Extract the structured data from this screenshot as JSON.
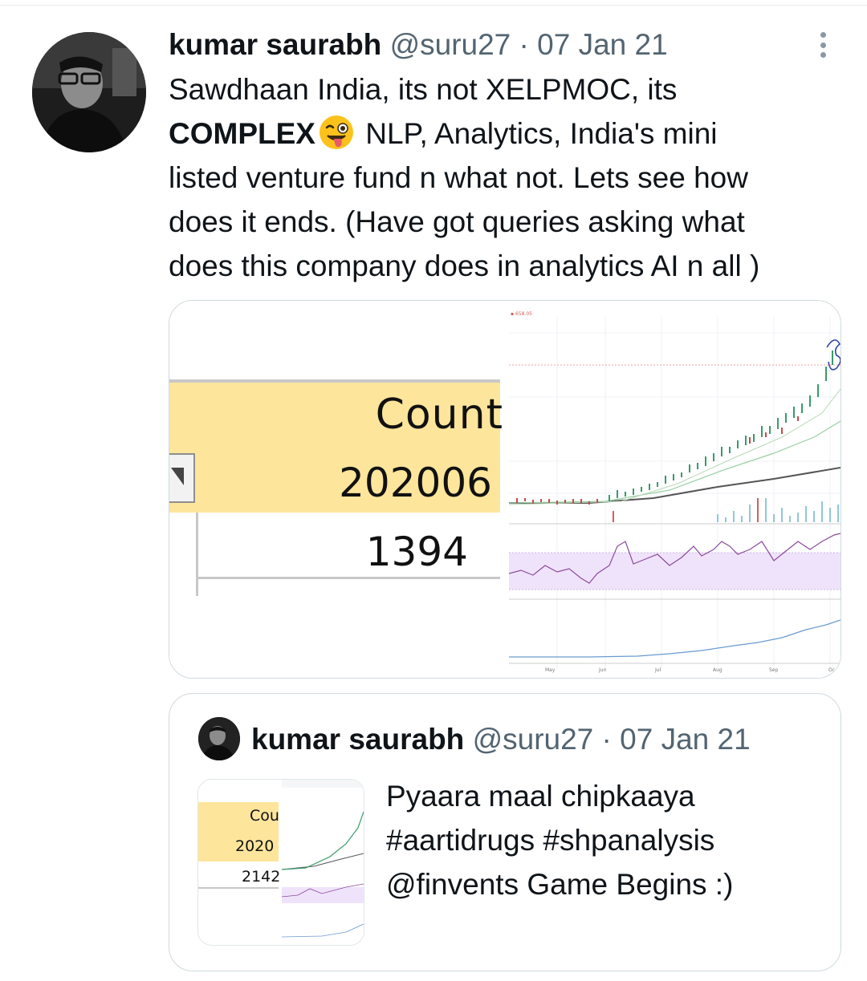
{
  "tweet": {
    "author_name": "kumar saurabh",
    "handle": "@suru27",
    "separator": "·",
    "date": "07 Jan 21",
    "text_line1": "Sawdhaan India, its not XELPMOC, its",
    "text_bold": "COMPLEX",
    "text_after_emoji": " NLP, Analytics, India's mini",
    "text_line3": "listed venture fund n what not. Lets see how",
    "text_line4": "does it ends. (Have got queries asking what",
    "text_line5": "does this company does in analytics AI n all )",
    "emoji_name": "winking-face-with-tongue-icon"
  },
  "media_left_sheet": {
    "header": "Count",
    "period": "202006",
    "value": "1394"
  },
  "media_right_chart": {
    "x_tick_labels": [
      "May",
      "Jun",
      "Jul",
      "Aug",
      "Sep",
      "Oc"
    ]
  },
  "quoted_tweet": {
    "author_name": "kumar saurabh",
    "handle": "@suru27",
    "separator": "·",
    "date": "07 Jan 21",
    "text_line1": "Pyaara maal chipkaaya",
    "text_line2": "#aartidrugs #shpanalysis",
    "text_line3": "@finvents Game Begins :)",
    "thumb_sheet": {
      "header": "Cou",
      "period": "2020",
      "value": "2142"
    }
  },
  "colors": {
    "text": "#0f1419",
    "secondary": "#536471",
    "border": "#cfd9de",
    "sheet_header": "#fde59c"
  }
}
